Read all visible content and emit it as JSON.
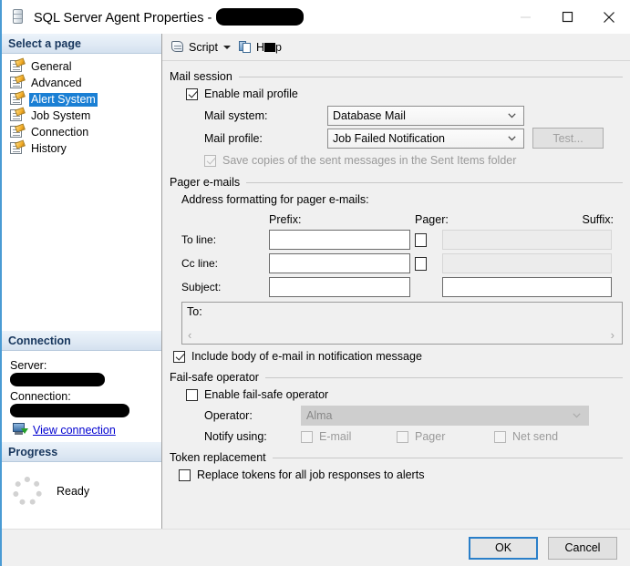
{
  "window": {
    "title": "SQL Server Agent Properties -",
    "title_redacted": true,
    "icon": "database-icon",
    "controls": {
      "minimize": "–",
      "maximize": "□",
      "close": "✕"
    }
  },
  "sidebar": {
    "header": "Select a page",
    "items": [
      {
        "label": "General",
        "selected": false
      },
      {
        "label": "Advanced",
        "selected": false
      },
      {
        "label": "Alert System",
        "selected": true
      },
      {
        "label": "Job System",
        "selected": false
      },
      {
        "label": "Connection",
        "selected": false
      },
      {
        "label": "History",
        "selected": false
      }
    ],
    "connection": {
      "header": "Connection",
      "server_label": "Server:",
      "server_value": "",
      "connection_label": "Connection:",
      "connection_value": "",
      "view_connection_link": "View connection"
    },
    "progress": {
      "header": "Progress",
      "status": "Ready"
    }
  },
  "toolbar": {
    "script_label": "Script",
    "help_label_prefix": "H",
    "help_label_suffix": "p"
  },
  "main": {
    "mail_session": {
      "title": "Mail session",
      "enable_mail_profile": {
        "label": "Enable mail profile",
        "checked": true
      },
      "mail_system": {
        "label": "Mail system:",
        "value": "Database Mail"
      },
      "mail_profile": {
        "label": "Mail profile:",
        "value": "Job Failed Notification"
      },
      "test_button": {
        "label": "Test...",
        "enabled": false
      },
      "save_copies": {
        "label": "Save copies of the sent messages in the Sent Items folder",
        "checked": true,
        "enabled": false
      }
    },
    "pager_emails": {
      "title": "Pager e-mails",
      "subtitle": "Address formatting for pager e-mails:",
      "columns": {
        "prefix": "Prefix:",
        "pager": "Pager:",
        "suffix": "Suffix:"
      },
      "rows": [
        {
          "label": "To line:",
          "prefix_value": "",
          "pager_checked": false,
          "suffix_value": "",
          "suffix_enabled": false
        },
        {
          "label": "Cc line:",
          "prefix_value": "",
          "pager_checked": false,
          "suffix_value": "",
          "suffix_enabled": false
        },
        {
          "label": "Subject:",
          "prefix_value": "",
          "pager_checked": null,
          "suffix_value": "",
          "suffix_enabled": true
        }
      ],
      "preview_text": "To:",
      "scroll_left": "‹",
      "scroll_right": "›",
      "include_body": {
        "label": "Include body of e-mail in notification message",
        "checked": true
      }
    },
    "fail_safe_operator": {
      "title": "Fail-safe operator",
      "enable": {
        "label": "Enable fail-safe operator",
        "checked": false
      },
      "operator": {
        "label": "Operator:",
        "value": "Alma",
        "enabled": false
      },
      "notify_using": {
        "label": "Notify using:",
        "options": [
          {
            "label": "E-mail",
            "checked": false,
            "enabled": false
          },
          {
            "label": "Pager",
            "checked": false,
            "enabled": false
          },
          {
            "label": "Net send",
            "checked": false,
            "enabled": false
          }
        ]
      }
    },
    "token_replacement": {
      "title": "Token replacement",
      "replace_tokens": {
        "label": "Replace tokens for all job responses to alerts",
        "checked": false
      }
    }
  },
  "footer": {
    "ok_label": "OK",
    "cancel_label": "Cancel"
  },
  "colors": {
    "selection_blue": "#1a7fd4",
    "link_blue": "#0000d0",
    "default_button_border": "#2a7fc9",
    "window_border": "#4a9bd4",
    "dialog_bg": "#f0f0f0"
  }
}
